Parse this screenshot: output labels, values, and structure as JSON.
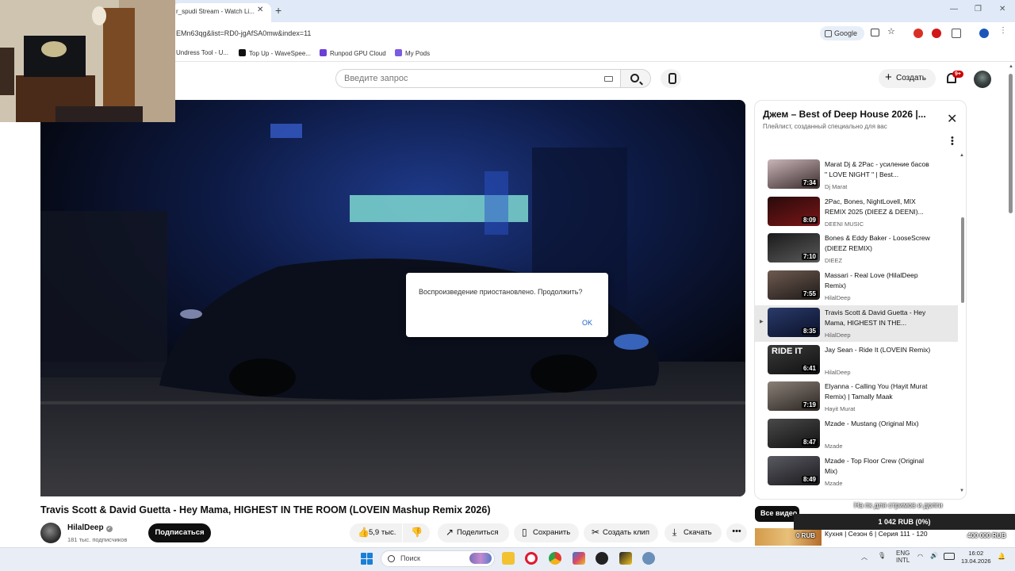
{
  "browser": {
    "tab_title": "r_spudi Stream - Watch Li...",
    "tab_close": "✕",
    "new_tab": "+",
    "url": "EMn63qg&list=RD0-jgAfSA0mw&index=11",
    "google_chip": "Google",
    "window_controls": [
      "—",
      "❐",
      "✕"
    ],
    "bookmarks": [
      {
        "label": "Undress Tool - U...",
        "color": "#9a9a9a"
      },
      {
        "label": "Top Up - WaveSpee...",
        "color": "#111111"
      },
      {
        "label": "Runpod GPU Cloud",
        "color": "#6a3fd6"
      },
      {
        "label": "My Pods",
        "color": "#7b5be0"
      }
    ]
  },
  "header": {
    "search_placeholder": "Введите запрос",
    "create_label": "Создать",
    "notifications_badge": "9+"
  },
  "player": {
    "dialog_message": "Воспроизведение приостановлено. Продолжить?",
    "dialog_ok": "OK"
  },
  "playlist": {
    "title": "Джем – Best of Deep House 2026 |...",
    "subtitle": "Плейлист, созданный специально для вас",
    "close_icon": "✕",
    "items": [
      {
        "title": "Marat Dj & 2Pac - усиление басов \" LOVE NIGHT \" | Best...",
        "channel": "Dj Marat",
        "duration": "7:34",
        "thumb": [
          "#c9b6b8",
          "#3a2a2c"
        ],
        "active": false
      },
      {
        "title": "2Pac, Bones, NightLovell, MIX REMIX 2025 (DIEEZ & DEENI)...",
        "channel": "DEENI MUSIC",
        "duration": "8:09",
        "thumb": [
          "#2a0a0c",
          "#7a1616"
        ],
        "active": false
      },
      {
        "title": "Bones & Eddy Baker - LooseScrew (DIEEZ REMIX)",
        "channel": "DIEEZ",
        "duration": "7:10",
        "thumb": [
          "#1a1a1a",
          "#5a5a5a"
        ],
        "active": false
      },
      {
        "title": "Massari - Real Love (HilalDeep Remix)",
        "channel": "HilalDeep",
        "duration": "7:55",
        "thumb": [
          "#6e5a50",
          "#1e1a18"
        ],
        "active": false
      },
      {
        "title": "Travis Scott & David Guetta - Hey Mama, HIGHEST IN THE...",
        "channel": "HilalDeep",
        "duration": "8:35",
        "thumb": [
          "#2a3a6a",
          "#0a1028"
        ],
        "active": true
      },
      {
        "title": "Jay Sean - Ride It (LOVEIN Remix)",
        "channel": "HilalDeep",
        "duration": "6:41",
        "thumb": [
          "#3a3a3a",
          "#101010"
        ],
        "active": false,
        "thumb_text": "RIDE IT"
      },
      {
        "title": "Elyanna - Calling You (Hayit Murat Remix) | Tamally Maak",
        "channel": "Hayit Murat",
        "duration": "7:19",
        "thumb": [
          "#8a8078",
          "#2a2420"
        ],
        "active": false
      },
      {
        "title": "Mzade - Mustang (Original Mix)",
        "channel": "Mzade",
        "duration": "8:47",
        "thumb": [
          "#4a4a4a",
          "#101010"
        ],
        "active": false
      },
      {
        "title": "Mzade - Top Floor Crew (Original Mix)",
        "channel": "Mzade",
        "duration": "8:49",
        "thumb": [
          "#5a5a62",
          "#18181c"
        ],
        "active": false
      }
    ]
  },
  "video": {
    "title": "Travis Scott & David Guetta - Hey Mama, HIGHEST IN THE ROOM (LOVEIN Mashup Remix 2026)",
    "channel": "HilalDeep",
    "subscribers": "181 тыс. подписчиков",
    "subscribe": "Подписаться",
    "likes": "5,9 тыс.",
    "share": "Поделиться",
    "save": "Сохранить",
    "clip": "Создать клип",
    "download": "Скачать",
    "more": "•••"
  },
  "recommendations": {
    "all_videos": "Все видео",
    "first_title": "Кухня | Сезон 6 | Серия 111 - 120"
  },
  "donation": {
    "caption": "На пк для стримов и долги",
    "progress": "1 042 RUB (0%)",
    "min": "0 RUB",
    "max": "400 000 RUB",
    "progress_fraction": 0.0026
  },
  "taskbar": {
    "search_label": "Поиск",
    "lang_top": "ENG",
    "lang_bottom": "INTL",
    "time": "16:02",
    "date": "13.04.2026"
  }
}
